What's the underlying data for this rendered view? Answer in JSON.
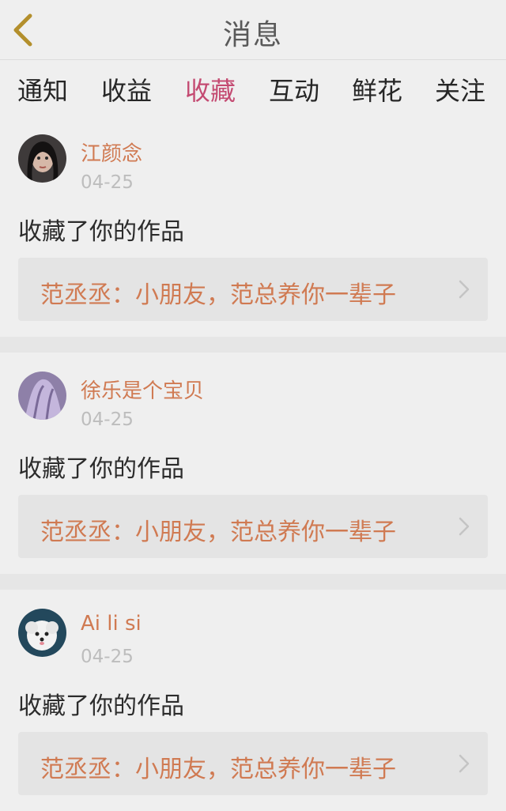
{
  "header": {
    "title": "消息",
    "back_icon": "chevron-left-icon",
    "accent": "#c44b72"
  },
  "tabs": [
    {
      "label": "通知",
      "active": false
    },
    {
      "label": "收益",
      "active": false
    },
    {
      "label": "收藏",
      "active": true
    },
    {
      "label": "互动",
      "active": false
    },
    {
      "label": "鲜花",
      "active": false
    },
    {
      "label": "关注",
      "active": false
    }
  ],
  "items": [
    {
      "username": "江颜念",
      "date": "04-25",
      "action": "收藏了你的作品",
      "work_title": "范丞丞：小朋友，范总养你一辈子",
      "avatar": "avatar-girl-portrait"
    },
    {
      "username": "徐乐是个宝贝",
      "date": "04-25",
      "action": "收藏了你的作品",
      "work_title": "范丞丞：小朋友，范总养你一辈子",
      "avatar": "avatar-purple-fabric"
    },
    {
      "username": "Ai li si",
      "date": "04-25",
      "action": "收藏了你的作品",
      "work_title": "范丞丞：小朋友，范总养你一辈子",
      "avatar": "avatar-white-puppy"
    }
  ]
}
